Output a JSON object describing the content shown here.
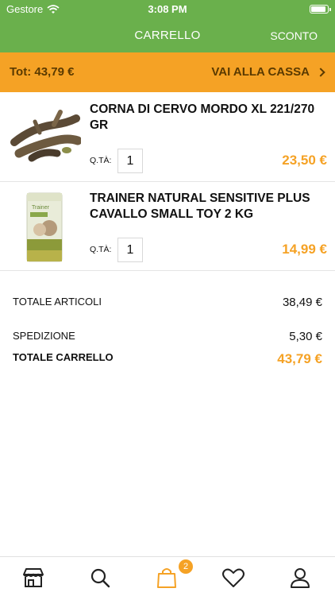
{
  "status_bar": {
    "carrier": "Gestore",
    "time": "3:08 PM"
  },
  "header": {
    "title": "CARRELLO",
    "discount_label": "SCONTO"
  },
  "total_bar": {
    "total": "Tot: 43,79 €",
    "checkout_label": "VAI ALLA CASSA"
  },
  "items": [
    {
      "name": "CORNA DI CERVO MORDO XL 221/270 GR",
      "qty_label": "Q.TÀ:",
      "qty": "1",
      "price": "23,50 €",
      "image": "antler-chew-image"
    },
    {
      "name": "TRAINER NATURAL SENSITIVE PLUS CAVALLO SMALL TOY 2 KG",
      "qty_label": "Q.TÀ:",
      "qty": "1",
      "price": "14,99 €",
      "image": "dog-food-bag-image"
    }
  ],
  "summary": {
    "subtotal_label": "TOTALE ARTICOLI",
    "subtotal": "38,49 €",
    "shipping_label": "SPEDIZIONE",
    "shipping": "5,30 €",
    "total_label": "TOTALE CARRELLO",
    "total": "43,79 €"
  },
  "tabbar": {
    "tabs": [
      "store-icon",
      "search-icon",
      "cart-icon",
      "heart-icon",
      "user-icon"
    ],
    "cart_badge": "2"
  },
  "colors": {
    "header_green": "#6ab04c",
    "accent_orange": "#f5a225"
  }
}
